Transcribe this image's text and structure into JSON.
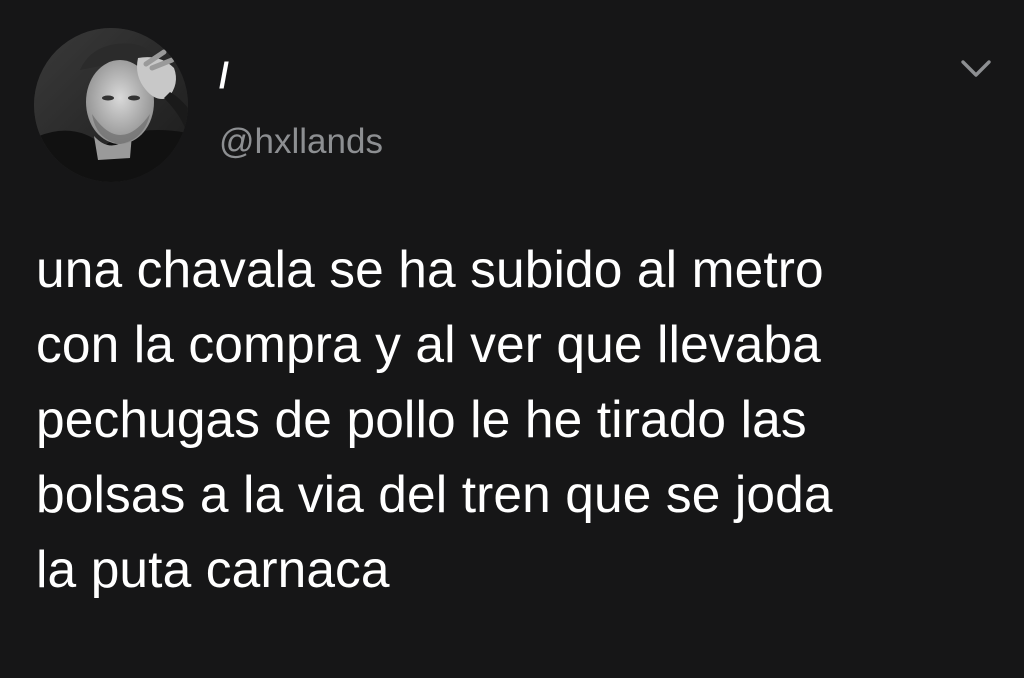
{
  "tweet": {
    "author": {
      "display_name": "/",
      "handle": "@hxllands",
      "avatar_icon": "profile-photo"
    },
    "menu_icon": "chevron-down-icon",
    "text": "una chavala se ha subido al metro\ncon la compra y al ver que llevaba\npechugas de pollo le he tirado las\nbolsas a la via del tren que se joda\nla puta carnaca"
  },
  "theme": {
    "background": "#161617",
    "text_primary": "#ffffff",
    "text_secondary": "#8d8f92"
  }
}
